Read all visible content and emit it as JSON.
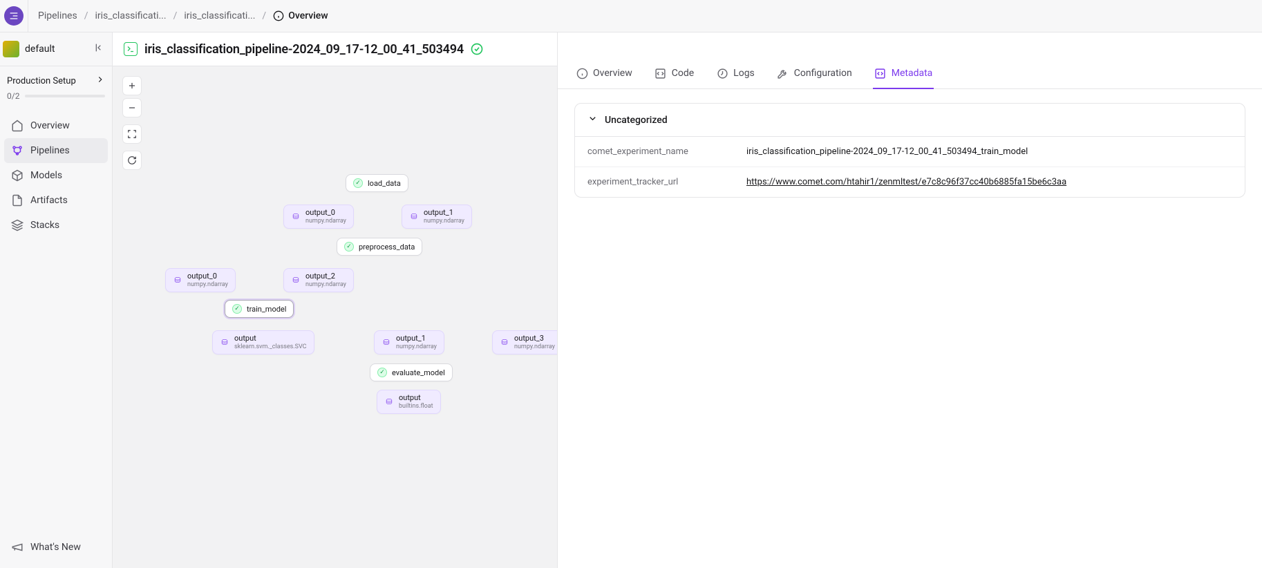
{
  "breadcrumb": {
    "items": [
      "Pipelines",
      "iris_classificati...",
      "iris_classificati..."
    ],
    "active": "Overview"
  },
  "workspace": {
    "name": "default"
  },
  "setup": {
    "title": "Production Setup",
    "progress_text": "0/2"
  },
  "sidebar": {
    "items": [
      {
        "label": "Overview"
      },
      {
        "label": "Pipelines"
      },
      {
        "label": "Models"
      },
      {
        "label": "Artifacts"
      },
      {
        "label": "Stacks"
      }
    ],
    "footer": {
      "label": "What's New"
    }
  },
  "run": {
    "title": "iris_classification_pipeline-2024_09_17-12_00_41_503494"
  },
  "dag": {
    "steps": {
      "load_data": "load_data",
      "preprocess_data": "preprocess_data",
      "train_model": "train_model",
      "evaluate_model": "evaluate_model"
    },
    "artifacts": {
      "ld_out0": {
        "name": "output_0",
        "type": "numpy.ndarray"
      },
      "ld_out1": {
        "name": "output_1",
        "type": "numpy.ndarray"
      },
      "pp_out0": {
        "name": "output_0",
        "type": "numpy.ndarray"
      },
      "pp_out2": {
        "name": "output_2",
        "type": "numpy.ndarray"
      },
      "tm_out": {
        "name": "output",
        "type": "sklearn.svm._classes.SVC"
      },
      "pp_out1": {
        "name": "output_1",
        "type": "numpy.ndarray"
      },
      "pp_out3": {
        "name": "output_3",
        "type": "numpy.ndarray"
      },
      "ev_out": {
        "name": "output",
        "type": "builtins.float"
      }
    }
  },
  "detail": {
    "title": "train_model",
    "status": "completed",
    "tabs": {
      "overview": "Overview",
      "code": "Code",
      "logs": "Logs",
      "configuration": "Configuration",
      "metadata": "Metadata"
    },
    "metadata": {
      "section": "Uncategorized",
      "rows": [
        {
          "key": "comet_experiment_name",
          "value": "iris_classification_pipeline-2024_09_17-12_00_41_503494_train_model",
          "link": false
        },
        {
          "key": "experiment_tracker_url",
          "value": "https://www.comet.com/htahir1/zenmltest/e7c8c96f37cc40b6885fa15be6c3aa",
          "link": true
        }
      ]
    }
  }
}
